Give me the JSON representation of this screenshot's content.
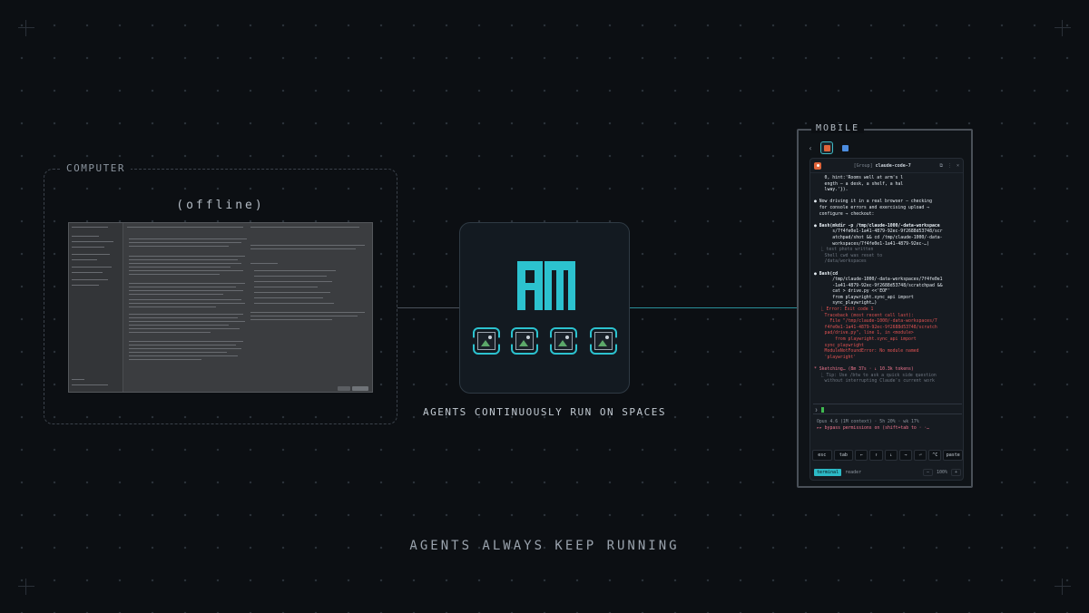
{
  "computer": {
    "title": "COMPUTER",
    "status": "(offline)"
  },
  "center": {
    "caption": "AGENTS CONTINUOUSLY RUN ON SPACES",
    "slot_icons": [
      "broken-image-icon",
      "broken-image-icon",
      "broken-image-icon",
      "broken-image-icon"
    ]
  },
  "footer": {
    "text": "AGENTS ALWAYS KEEP RUNNING"
  },
  "mobile": {
    "title": "MOBILE",
    "tab_colors": [
      "#e0643a",
      "#4c8de0"
    ],
    "header": {
      "group": "[Group]",
      "name": "claude-code-7",
      "controls": [
        "⧉",
        "⋮",
        "×"
      ]
    },
    "log": [
      {
        "cls": "w",
        "text": "    0, hint:'Rooms well at arm's l"
      },
      {
        "cls": "w",
        "text": "    ength — a desk, a shelf, a hal"
      },
      {
        "cls": "w",
        "text": "    lway.'})."
      },
      {
        "cls": "",
        "text": " "
      },
      {
        "cls": "w",
        "text": "● Now driving it in a real browser — checking"
      },
      {
        "cls": "w",
        "text": "  for console errors and exercising upload →"
      },
      {
        "cls": "w",
        "text": "  configure → checkout:"
      },
      {
        "cls": "",
        "text": " "
      },
      {
        "cls": "b",
        "text": "● Bash(mkdir -p /tmp/claude-1000/-data-workspace"
      },
      {
        "cls": "w",
        "text": "       s/7f4fe0e1-1a41-4879-92ec-9f2688d53748/scr"
      },
      {
        "cls": "w",
        "text": "       atchpad/shot && cd /tmp/claude-1000/-data-"
      },
      {
        "cls": "w",
        "text": "       workspaces/7f4fe0e1-1a41-4879-92ec-…)"
      },
      {
        "cls": "m",
        "text": "  ⎿ test photo written"
      },
      {
        "cls": "m",
        "text": "    Shell cwd was reset to"
      },
      {
        "cls": "m",
        "text": "    /data/workspaces"
      },
      {
        "cls": "",
        "text": " "
      },
      {
        "cls": "b",
        "text": "● Bash(cd"
      },
      {
        "cls": "w",
        "text": "       /tmp/claude-1000/-data-workspaces/7f4fe0e1"
      },
      {
        "cls": "w",
        "text": "       -1a41-4879-92ec-9f2688d53748/scratchpad &&"
      },
      {
        "cls": "w",
        "text": "       cat > drive.py <<'EOF'"
      },
      {
        "cls": "w",
        "text": "       from playwright.sync_api import"
      },
      {
        "cls": "w",
        "text": "       sync_playwright…)"
      },
      {
        "cls": "rr",
        "text": "  ⎿ Error: Exit code 1"
      },
      {
        "cls": "rr",
        "text": "    Traceback (most recent call last):"
      },
      {
        "cls": "rr",
        "text": "      File \"/tmp/claude-1000/-data-workspaces/7"
      },
      {
        "cls": "rr",
        "text": "    f4fe0e1-1a41-4879-92ec-9f2688d53748/scratch"
      },
      {
        "cls": "rr",
        "text": "    pad/drive.py\", line 1, in <module>"
      },
      {
        "cls": "rr",
        "text": "        from playwright.sync_api import"
      },
      {
        "cls": "rr",
        "text": "    sync_playwright"
      },
      {
        "cls": "rr",
        "text": "    ModuleNotFoundError: No module named"
      },
      {
        "cls": "rr",
        "text": "    'playwright'"
      },
      {
        "cls": "",
        "text": " "
      },
      {
        "cls": "p",
        "text": "* Sketching… (8m 37s · ↓ 10.3k tokens)"
      },
      {
        "cls": "m",
        "text": "  ⎿ Tip: Use /btw to ask a quick side question"
      },
      {
        "cls": "m",
        "text": "    without interrupting Claude's current work"
      }
    ],
    "prompt": "❯",
    "status": [
      "Opus 4.6 (1M context) · 5h 20% · wk 17%",
      "▸▸ bypass permissions on (shift+tab to · ·…"
    ],
    "keys": [
      "esc",
      "tab",
      "←",
      "↑",
      "↓",
      "→",
      "⏎",
      "^C",
      "paste"
    ],
    "bar": {
      "mode1": "terminal",
      "mode2": "reader",
      "zoom_minus": "−",
      "zoom": "100%",
      "zoom_plus": "+"
    }
  }
}
